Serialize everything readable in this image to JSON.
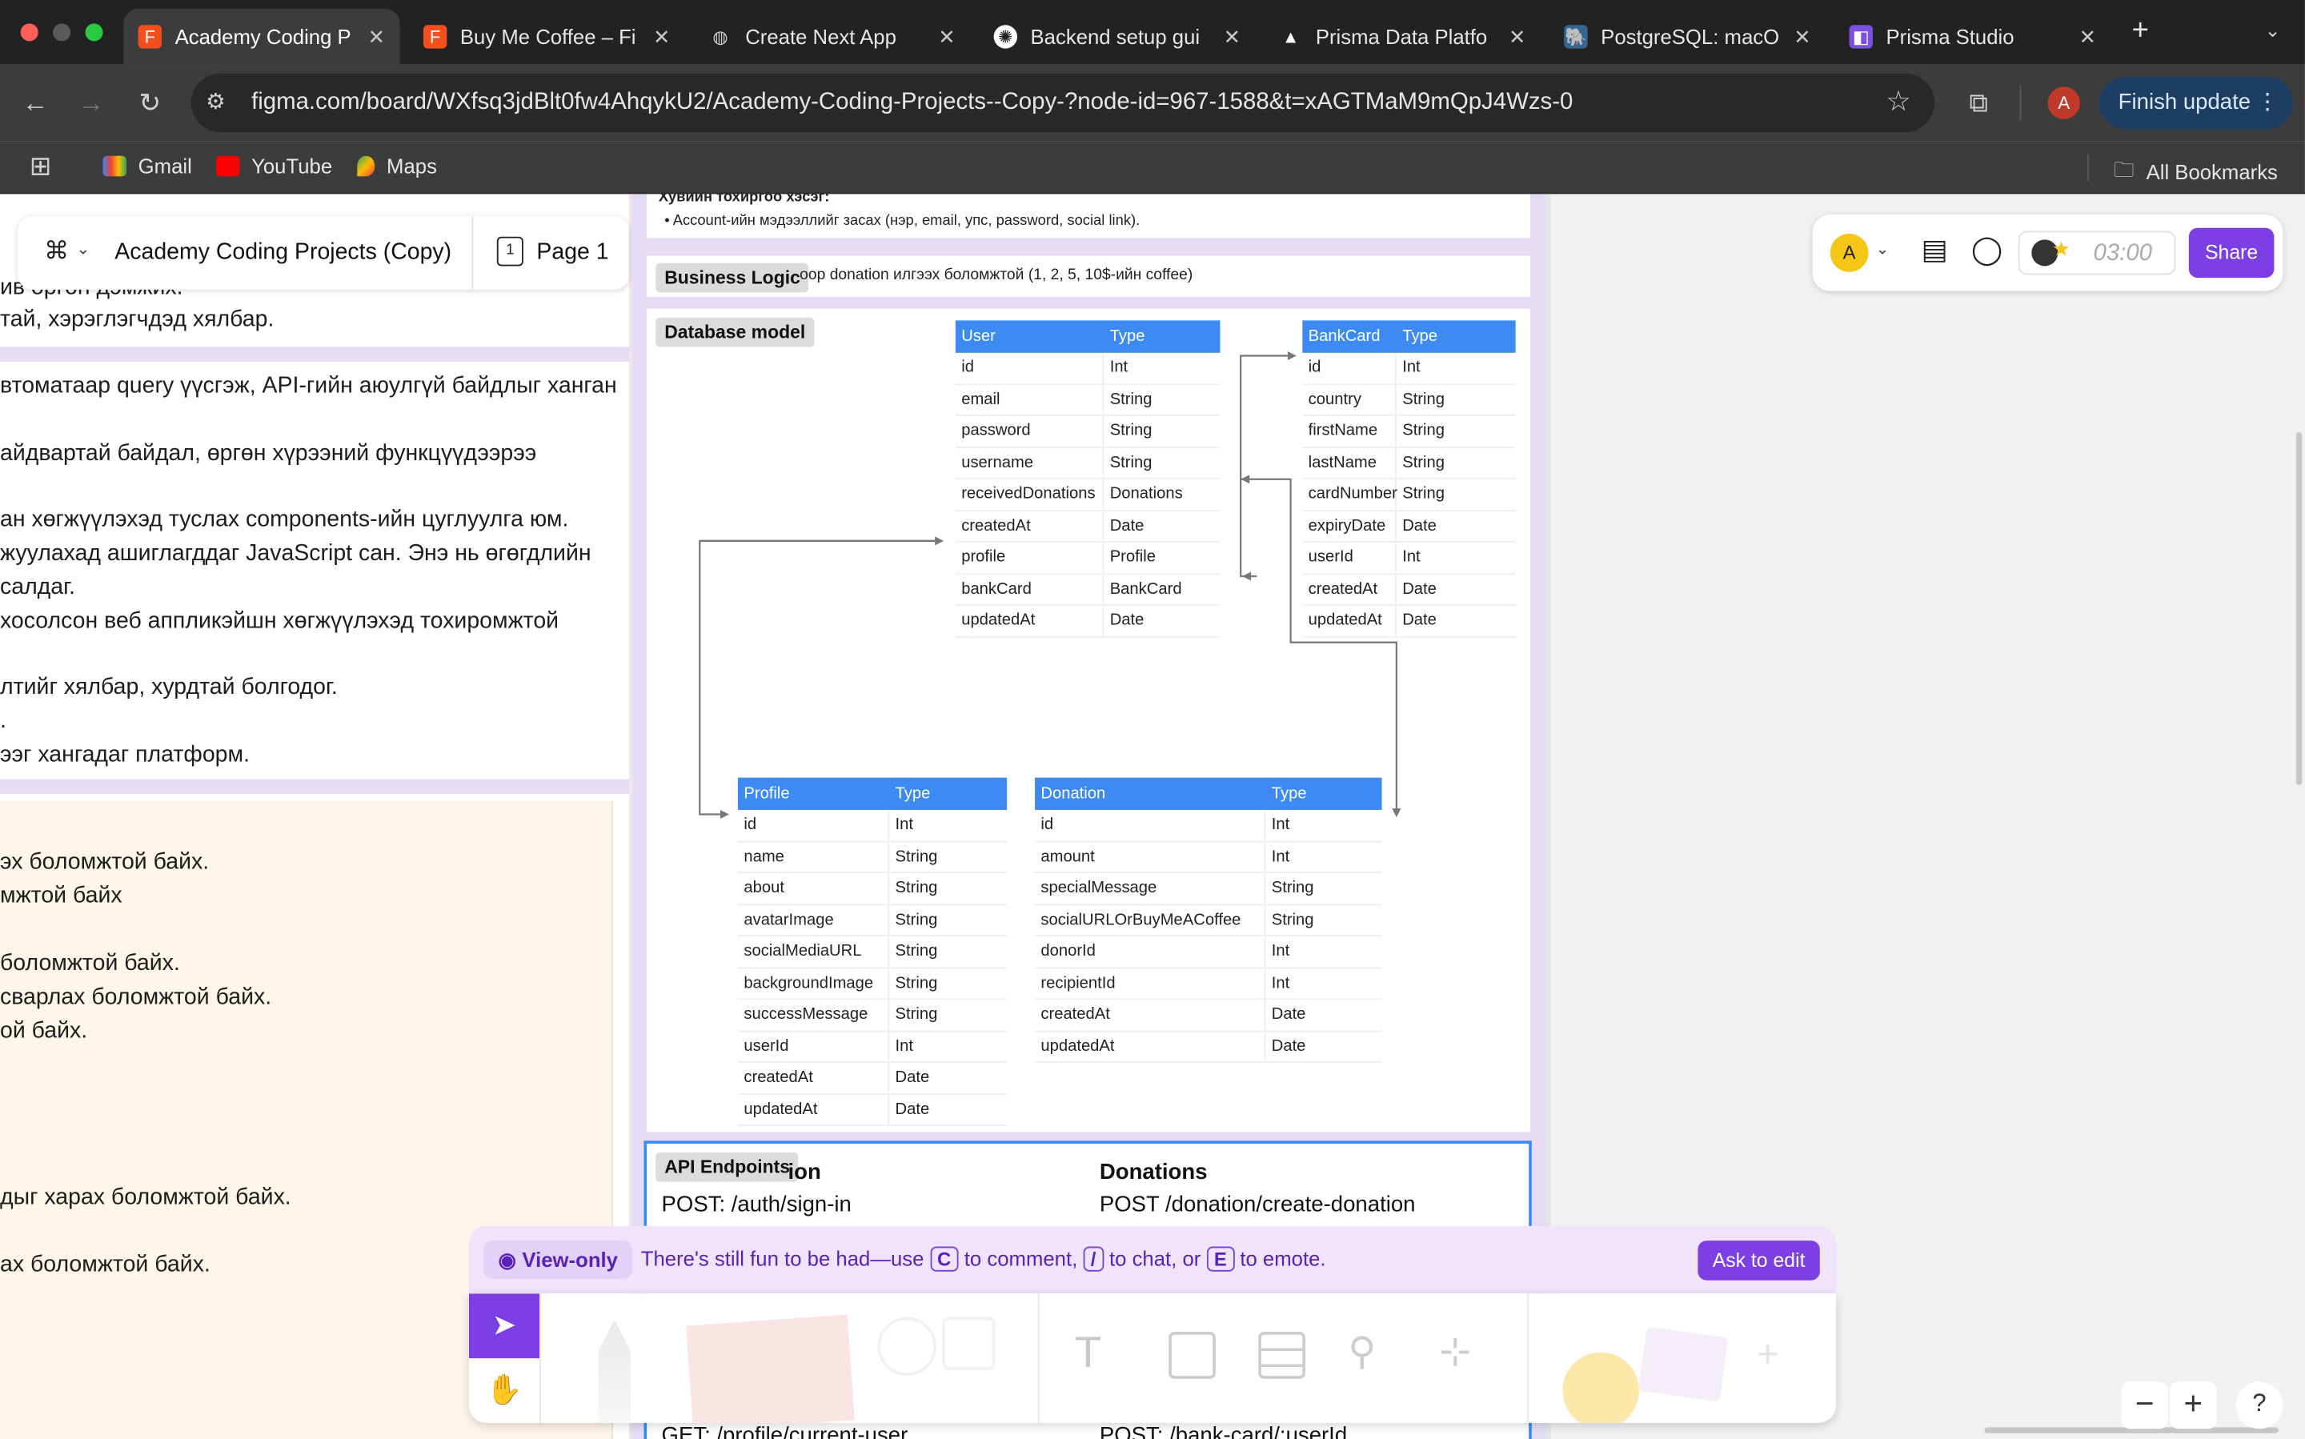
{
  "browser": {
    "tabs": [
      {
        "title": "Academy Coding P",
        "active": true,
        "favicon": "figma-icon"
      },
      {
        "title": "Buy Me Coffee – Fi",
        "active": false,
        "favicon": "figma-icon"
      },
      {
        "title": "Create Next App",
        "active": false,
        "favicon": "globe-icon"
      },
      {
        "title": "Backend setup gui",
        "active": false,
        "favicon": "chatgpt-icon"
      },
      {
        "title": "Prisma Data Platfo",
        "active": false,
        "favicon": "prisma-icon"
      },
      {
        "title": "PostgreSQL: macO",
        "active": false,
        "favicon": "postgres-icon"
      },
      {
        "title": "Prisma Studio",
        "active": false,
        "favicon": "prisma-studio-icon"
      }
    ],
    "new_tab": "+",
    "url": "figma.com/board/WXfsq3jdBlt0fw4AhqykU2/Academy-Coding-Projects--Copy-?node-id=967-1588&t=xAGTMaM9mQpJ4Wzs-0",
    "profile_initial": "A",
    "finish_update": "Finish update",
    "bookmarks": [
      {
        "label": "Gmail",
        "icon": "gmail-icon"
      },
      {
        "label": "YouTube",
        "icon": "youtube-icon"
      },
      {
        "label": "Maps",
        "icon": "maps-icon"
      }
    ],
    "all_bookmarks": "All Bookmarks",
    "colors": {
      "tab_strip": "#222222",
      "toolbar": "#3c3c3c",
      "finish_update_bg": "#1e3d63"
    }
  },
  "figma": {
    "file_title": "Academy Coding Projects (Copy)",
    "page": "Page 1",
    "user_initial": "A",
    "timer": "03:00",
    "share": "Share",
    "view_only": {
      "label": "View-only",
      "message_start": "There's still fun to be had—use",
      "key_comment": "C",
      "to_comment": "to comment,",
      "key_chat": "/",
      "to_chat": "to chat, or",
      "key_emote": "E",
      "to_emote": "to emote.",
      "ask_to_edit": "Ask to edit"
    },
    "colors": {
      "accent": "#7b3fe4",
      "table_header": "#3d8bf2",
      "section_band": "#e6dcf5"
    }
  },
  "left_doc": {
    "lines": [
      "ив өргөн дэмжих.",
      "тай, хэрэглэгчдэд хялбар.",
      "втоматаар query үүсгэж, API-гийн аюулгүй байдлыг ханган",
      "айдвартай байдал, өргөн хүрээний функцүүдээрээ",
      "ан хөгжүүлэхэд туслах components-ийн цуглуулга юм.",
      "жуулахад ашиглагддаг JavaScript сан. Энэ нь өгөгдлийн",
      "салдаг.",
      "хосолсон веб аппликэйшн хөгжүүлэхэд тохиромжтой",
      "лтийг хялбар, хурдтай болгодог.",
      ".",
      "ээг хангадаг платформ.",
      "эх боломжтой байх.",
      "мжтой байх",
      "боломжтой байх.",
      "сварлах боломжтой байх.",
      "ой байх.",
      "дыг харах боломжтой байх.",
      "ах боломжтой байх."
    ]
  },
  "board": {
    "profile_settings_heading": "Хувийн тохиргоо хэсэг:",
    "profile_settings_bullet": "Account-ийн мэдээллийг засах (нэр, email, упс, password, social link).",
    "business_logic_label": "Business Logic",
    "business_logic_text": "оор donation илгээх боломжтой (1, 2, 5, 10$-ийн coffee)",
    "database_model_label": "Database model",
    "api_endpoints_label": "API Endpoints",
    "api_col1_heading": "ion",
    "api_col2_heading": "Donations",
    "api_col1_line1": "POST: /auth/sign-in",
    "api_col2_line1": "POST /donation/create-donation",
    "api_col1_line2": "GET: /profile/current-user",
    "api_col2_line2": "POST: /bank-card/:userId",
    "tables": {
      "user": {
        "headers": [
          "User",
          "Type"
        ],
        "rows": [
          [
            "id",
            "Int"
          ],
          [
            "email",
            "String"
          ],
          [
            "password",
            "String"
          ],
          [
            "username",
            "String"
          ],
          [
            "receivedDonations",
            "Donations"
          ],
          [
            "createdAt",
            "Date"
          ],
          [
            "profile",
            "Profile"
          ],
          [
            "bankCard",
            "BankCard"
          ],
          [
            "updatedAt",
            "Date"
          ]
        ]
      },
      "bankcard": {
        "headers": [
          "BankCard",
          "Type"
        ],
        "rows": [
          [
            "id",
            "Int"
          ],
          [
            "country",
            "String"
          ],
          [
            "firstName",
            "String"
          ],
          [
            "lastName",
            "String"
          ],
          [
            "cardNumber",
            "String"
          ],
          [
            "expiryDate",
            "Date"
          ],
          [
            "userId",
            "Int"
          ],
          [
            "createdAt",
            "Date"
          ],
          [
            "updatedAt",
            "Date"
          ]
        ]
      },
      "profile": {
        "headers": [
          "Profile",
          "Type"
        ],
        "rows": [
          [
            "id",
            "Int"
          ],
          [
            "name",
            "String"
          ],
          [
            "about",
            "String"
          ],
          [
            "avatarImage",
            "String"
          ],
          [
            "socialMediaURL",
            "String"
          ],
          [
            "backgroundImage",
            "String"
          ],
          [
            "successMessage",
            "String"
          ],
          [
            "userId",
            "Int"
          ],
          [
            "createdAt",
            "Date"
          ],
          [
            "updatedAt",
            "Date"
          ]
        ]
      },
      "donation": {
        "headers": [
          "Donation",
          "Type"
        ],
        "rows": [
          [
            "id",
            "Int"
          ],
          [
            "amount",
            "Int"
          ],
          [
            "specialMessage",
            "String"
          ],
          [
            "socialURLOrBuyMeACoffee",
            "String"
          ],
          [
            "donorId",
            "Int"
          ],
          [
            "recipientId",
            "Int"
          ],
          [
            "createdAt",
            "Date"
          ],
          [
            "updatedAt",
            "Date"
          ]
        ]
      }
    }
  },
  "zoom": {
    "minus": "−",
    "plus": "+",
    "help": "?"
  }
}
